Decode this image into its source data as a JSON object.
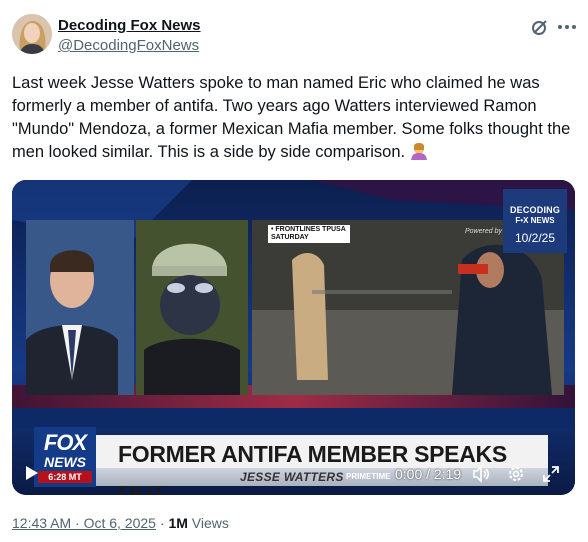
{
  "author": {
    "display_name": "Decoding Fox News",
    "handle": "@DecodingFoxNews"
  },
  "tweet_text": "Last week Jesse Watters spoke to man named Eric who claimed he was formerly a member of antifa. Two years ago Watters interviewed Ramon \"Mundo\" Mendoza, a former Mexican Mafia member. Some folks thought the men looked similar. This is a side by side comparison.",
  "icons": {
    "header": [
      "grok-icon",
      "more-icon"
    ],
    "emoji": "person-shrugging-emoji",
    "controls": [
      "play-icon",
      "volume-icon",
      "gear-icon",
      "expand-icon"
    ]
  },
  "video": {
    "watermark": {
      "line1": "DECODING",
      "line2": "F•X NEWS",
      "date": "10/2/25"
    },
    "chyron": "FORMER ANTIFA MEMBER SPEAKS OUT",
    "show_name": "JESSE WATTERS",
    "show_suffix": "PRIMETIME",
    "network_logo": {
      "line1": "FOX",
      "line2": "NEWS",
      "clock": "6:28 MT"
    },
    "insert_label": "• FRONTLINES TPUSA\nSATURDAY",
    "powered_by": "Powered by",
    "time_display": "0:00 / 2:19"
  },
  "metadata": {
    "timestamp": "12:43 AM · Oct 6, 2025",
    "separator": " · ",
    "views_count": "1M",
    "views_label": " Views"
  },
  "colors": {
    "text": "#0f1419",
    "secondary": "#536471",
    "fox_blue": "#133b88",
    "fox_red": "#b5121b"
  }
}
